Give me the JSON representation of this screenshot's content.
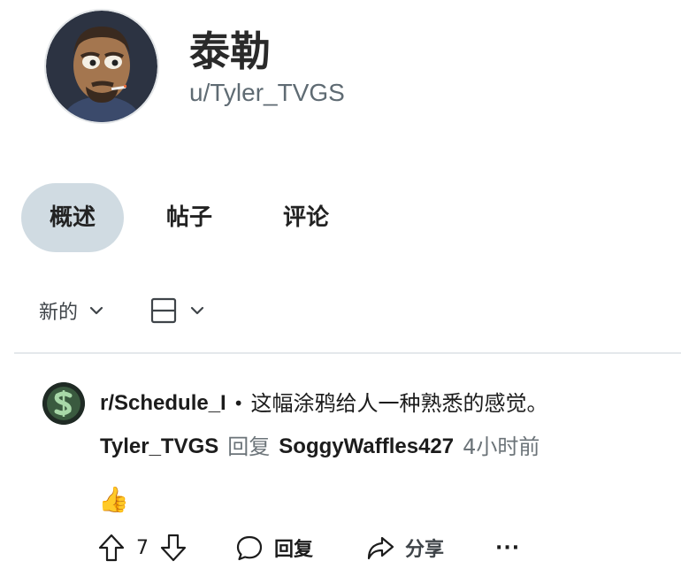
{
  "profile": {
    "display_name": "泰勒",
    "username": "u/Tyler_TVGS"
  },
  "tabs": [
    {
      "label": "概述",
      "active": true
    },
    {
      "label": "帖子",
      "active": false
    },
    {
      "label": "评论",
      "active": false
    }
  ],
  "feed_controls": {
    "sort_label": "新的",
    "icons": [
      "chevron-down-icon",
      "view-layout-icon"
    ]
  },
  "comment": {
    "subreddit": "r/Schedule_I",
    "separator": "•",
    "post_title": "这幅涂鸦给人一种熟悉的感觉。",
    "author": "Tyler_TVGS",
    "reply_word": "回复",
    "parent_author": "SoggyWaffles427",
    "age": "4小时前",
    "body": "👍",
    "actions": {
      "score": "7",
      "reply_label": "回复",
      "share_label": "分享",
      "more_label": "···"
    }
  },
  "colors": {
    "active_tab_bg": "#d0dbe2",
    "muted_text": "#6b7378",
    "divider": "#e4e8eb"
  }
}
